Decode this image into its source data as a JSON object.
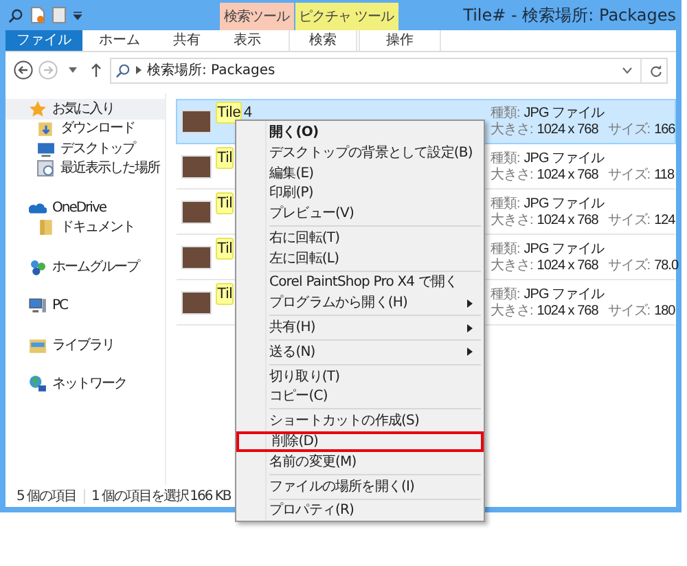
{
  "window": {
    "title": "Tile# - 検索場所: Packages"
  },
  "ribbon": {
    "tabs": [
      {
        "label": "ファイル",
        "kind": "file"
      },
      {
        "label": "ホーム",
        "kind": "plain"
      },
      {
        "label": "共有",
        "kind": "plain"
      },
      {
        "label": "表示",
        "kind": "plain"
      }
    ],
    "context_groups": [
      {
        "label": "検索ツール",
        "color": "#f9c9b5",
        "tabs": [
          "検索"
        ]
      },
      {
        "label": "ピクチャ ツール",
        "color": "#f2f07c",
        "tabs": [
          "操作"
        ]
      }
    ]
  },
  "address_bar": {
    "path": "検索場所: Packages",
    "forward_disabled": true
  },
  "sidebar": {
    "groups": [
      {
        "label": "お気に入り",
        "kind": "star",
        "selected": true,
        "children": [
          {
            "label": "ダウンロード",
            "kind": "download",
            "selected": false
          },
          {
            "label": "デスクトップ",
            "kind": "desktop",
            "selected": false
          },
          {
            "label": "最近表示した場所",
            "kind": "recent",
            "selected": false
          }
        ]
      },
      {
        "label": "OneDrive",
        "kind": "cloud",
        "selected": false,
        "children": [
          {
            "label": "ドキュメント",
            "kind": "folder",
            "selected": false
          }
        ]
      },
      {
        "label": "ホームグループ",
        "kind": "homegroup",
        "selected": false
      },
      {
        "label": "PC",
        "kind": "pc",
        "selected": false
      },
      {
        "label": "ライブラリ",
        "kind": "library",
        "selected": false
      },
      {
        "label": "ネットワーク",
        "kind": "network",
        "selected": false
      }
    ]
  },
  "files": [
    {
      "name_parts": [
        {
          "text": "Tile",
          "match": true
        },
        {
          "text": "4",
          "match": false
        }
      ],
      "selected": true,
      "type_label": "種類:",
      "type": "JPG ファイル",
      "dims_label": "大きさ:",
      "dims": "1024 x 768",
      "size_label": "サイズ:",
      "size": "166"
    },
    {
      "name_parts": [
        {
          "text": "Til",
          "match": true
        }
      ],
      "selected": false,
      "type_label": "種類:",
      "type": "JPG ファイル",
      "dims_label": "大きさ:",
      "dims": "1024 x 768",
      "size_label": "サイズ:",
      "size": "118"
    },
    {
      "name_parts": [
        {
          "text": "Til",
          "match": true
        }
      ],
      "selected": false,
      "type_label": "種類:",
      "type": "JPG ファイル",
      "dims_label": "大きさ:",
      "dims": "1024 x 768",
      "size_label": "サイズ:",
      "size": "124"
    },
    {
      "name_parts": [
        {
          "text": "Til",
          "match": true
        }
      ],
      "selected": false,
      "type_label": "種類:",
      "type": "JPG ファイル",
      "dims_label": "大きさ:",
      "dims": "1024 x 768",
      "size_label": "サイズ:",
      "size": "78.0"
    },
    {
      "name_parts": [
        {
          "text": "Til",
          "match": true
        }
      ],
      "selected": false,
      "type_label": "種類:",
      "type": "JPG ファイル",
      "dims_label": "大きさ:",
      "dims": "1024 x 768",
      "size_label": "サイズ:",
      "size": "180"
    }
  ],
  "status_bar": {
    "count": "5 個の項目",
    "selection": "1 個の項目を選択",
    "size": "166 KB"
  },
  "context_menu": {
    "groups": [
      {
        "items": [
          {
            "label": "開く(O)",
            "default": true,
            "submenu": false,
            "highlighted": false
          },
          {
            "label": "デスクトップの背景として設定(B)",
            "default": false,
            "submenu": false,
            "highlighted": false
          },
          {
            "label": "編集(E)",
            "default": false,
            "submenu": false,
            "highlighted": false
          },
          {
            "label": "印刷(P)",
            "default": false,
            "submenu": false,
            "highlighted": false
          },
          {
            "label": "プレビュー(V)",
            "default": false,
            "submenu": false,
            "highlighted": false
          }
        ]
      },
      {
        "items": [
          {
            "label": "右に回転(T)",
            "default": false,
            "submenu": false,
            "highlighted": false
          },
          {
            "label": "左に回転(L)",
            "default": false,
            "submenu": false,
            "highlighted": false
          }
        ]
      },
      {
        "items": [
          {
            "label": "Corel PaintShop Pro X4 で開く",
            "default": false,
            "submenu": false,
            "highlighted": false
          },
          {
            "label": "プログラムから開く(H)",
            "default": false,
            "submenu": true,
            "highlighted": false
          }
        ]
      },
      {
        "items": [
          {
            "label": "共有(H)",
            "default": false,
            "submenu": true,
            "highlighted": false
          }
        ]
      },
      {
        "items": [
          {
            "label": "送る(N)",
            "default": false,
            "submenu": true,
            "highlighted": false
          }
        ]
      },
      {
        "items": [
          {
            "label": "切り取り(T)",
            "default": false,
            "submenu": false,
            "highlighted": false
          },
          {
            "label": "コピー(C)",
            "default": false,
            "submenu": false,
            "highlighted": false
          }
        ]
      },
      {
        "items": [
          {
            "label": "ショートカットの作成(S)",
            "default": false,
            "submenu": false,
            "highlighted": false
          },
          {
            "label": "削除(D)",
            "default": false,
            "submenu": false,
            "highlighted": true
          },
          {
            "label": "名前の変更(M)",
            "default": false,
            "submenu": false,
            "highlighted": false
          }
        ]
      },
      {
        "items": [
          {
            "label": "ファイルの場所を開く(I)",
            "default": false,
            "submenu": false,
            "highlighted": false
          }
        ]
      },
      {
        "items": [
          {
            "label": "プロパティ(R)",
            "default": false,
            "submenu": false,
            "highlighted": false
          }
        ]
      }
    ]
  }
}
